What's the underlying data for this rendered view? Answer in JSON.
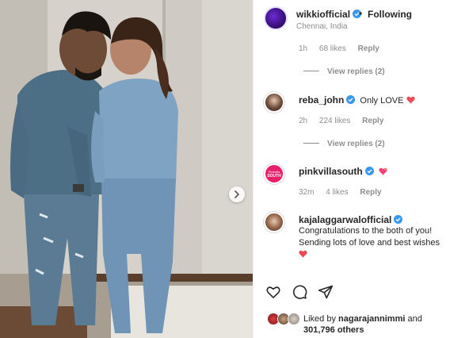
{
  "post": {
    "author": "wikkiofficial",
    "follow_status": "Following",
    "location": "Chennai, India"
  },
  "comments": [
    {
      "time": "1h",
      "likes": "68 likes",
      "reply": "Reply",
      "view_replies": "View replies (2)"
    },
    {
      "username": "reba_john",
      "text": "Only LOVE",
      "time": "2h",
      "likes": "224 likes",
      "reply": "Reply",
      "view_replies": "View replies (2)"
    },
    {
      "username": "pinkvillasouth",
      "avatar_text": "SOUTH",
      "avatar_small_text": "Pinkvilla",
      "time": "32m",
      "likes": "4 likes",
      "reply": "Reply"
    },
    {
      "username": "kajalaggarwalofficial",
      "text_line1": "Congratulations to the both of you!",
      "text_line2": "Sending lots of love and best wishes"
    }
  ],
  "actions": {
    "like_icon": "heart-outline-icon",
    "comment_icon": "comment-bubble-icon",
    "share_icon": "paper-plane-icon"
  },
  "likes": {
    "prefix": "Liked by",
    "user": "nagarajannimmi",
    "suffix": "and",
    "count": "301,796 others"
  },
  "colors": {
    "verified": "#3897f0",
    "heart": "#ed4956",
    "pinkvilla": "#e8206a"
  }
}
